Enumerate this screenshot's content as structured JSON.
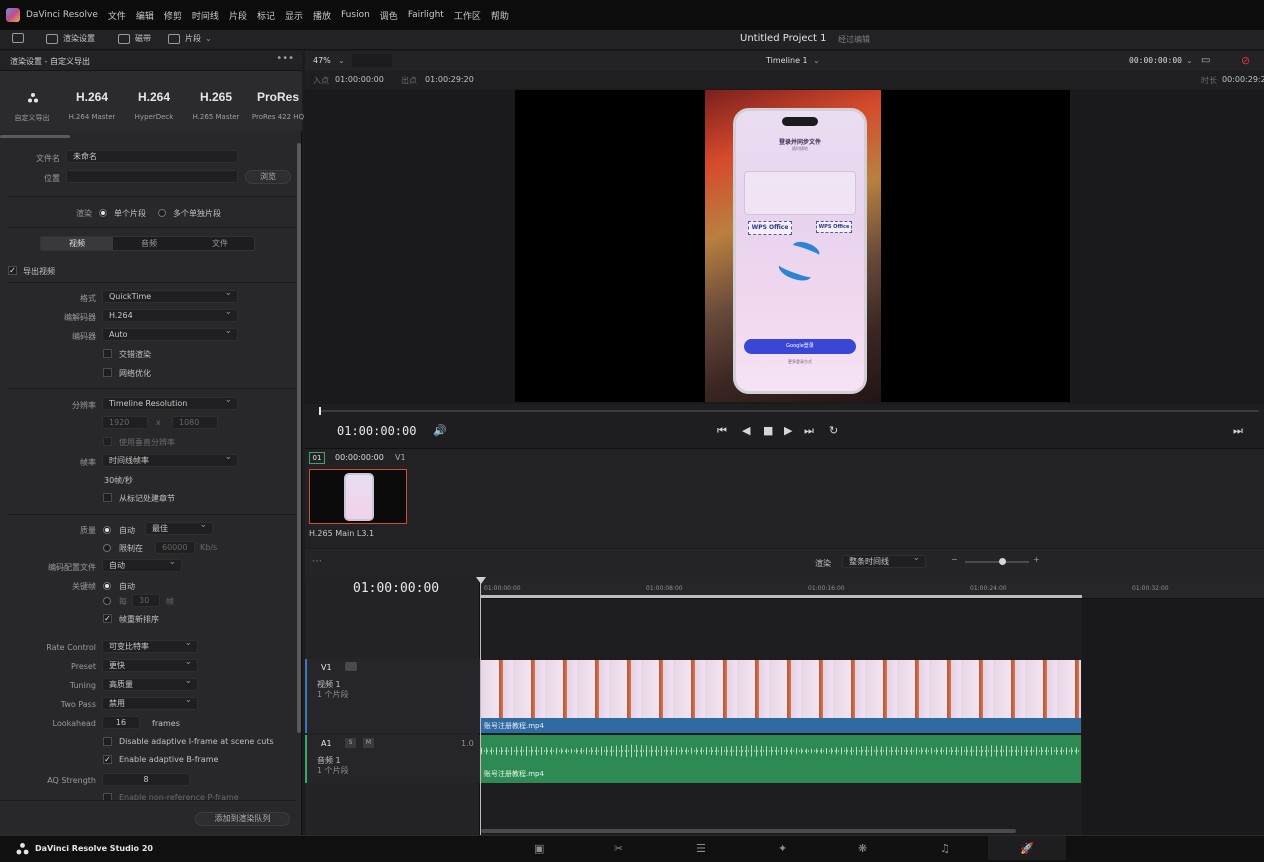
{
  "menubar": {
    "app": "DaVinci Resolve",
    "items": [
      "文件",
      "编辑",
      "修剪",
      "时间线",
      "片段",
      "标记",
      "显示",
      "播放",
      "Fusion",
      "调色",
      "Fairlight",
      "工作区",
      "帮助"
    ]
  },
  "toolbar": {
    "render_settings": "渲染设置",
    "clips": "磁带",
    "clip_label": "片段",
    "project_title": "Untitled Project 1",
    "project_sub": "经过编辑"
  },
  "render": {
    "header": "渲染设置 - 自定义导出",
    "presets": [
      {
        "name": "",
        "sub": "自定义导出"
      },
      {
        "name": "H.264",
        "sub": "H.264 Master"
      },
      {
        "name": "H.264",
        "sub": "HyperDeck"
      },
      {
        "name": "H.265",
        "sub": "H.265 Master"
      },
      {
        "name": "ProRes",
        "sub": "ProRes 422 HQ"
      }
    ],
    "filename_label": "文件名",
    "filename_value": "未命名",
    "location_label": "位置",
    "location_value": "",
    "browse": "浏览",
    "render_label": "渲染",
    "single_clip": "单个片段",
    "multi_clip": "多个单独片段",
    "tabs": [
      "视频",
      "音频",
      "文件"
    ],
    "export_video": "导出视频",
    "format_label": "格式",
    "format_value": "QuickTime",
    "codec_label": "编解码器",
    "codec_value": "H.264",
    "encoder_label": "编码器",
    "encoder_value": "Auto",
    "interlace": "交错渲染",
    "network_opt": "网络优化",
    "resolution_label": "分辨率",
    "resolution_value": "Timeline Resolution",
    "res_w": "1920",
    "res_x": "x",
    "res_h": "1080",
    "res_custom": "使用垂直分辨率",
    "framerate_label": "帧率",
    "framerate_value": "时间线帧率",
    "fps_value": "30帧/秒",
    "timecode_label": "从标记处建章节",
    "quality_label": "质量",
    "quality_auto": "自动",
    "quality_auto_value": "最佳",
    "quality_limit": "限制在",
    "quality_limit_value": "60000",
    "quality_limit_unit": "Kb/s",
    "profile_label": "编码配置文件",
    "profile_value": "自动",
    "keyframe_label": "关键帧",
    "keyframe_auto": "自动",
    "keyframe_every": "每",
    "keyframe_every_value": "30",
    "keyframe_every_unit": "帧",
    "frame_reorder": "帧重新排序",
    "rate_control_label": "Rate Control",
    "rate_control_value": "可变比特率",
    "preset_label": "Preset",
    "preset_value": "更快",
    "tuning_label": "Tuning",
    "tuning_value": "高质量",
    "twopass_label": "Two Pass",
    "twopass_value": "禁用",
    "lookahead_label": "Lookahead",
    "lookahead_value": "16",
    "lookahead_unit": "frames",
    "disable_iframe": "Disable adaptive I-frame at scene cuts",
    "enable_bframe": "Enable adaptive B-frame",
    "aq_label": "AQ Strength",
    "aq_value": "8",
    "nonref": "Enable non-reference P-frame",
    "add_queue": "添加到渲染队列"
  },
  "viewer": {
    "zoom": "47%",
    "timeline_name": "Timeline 1",
    "timecode_top": "00:00:00:00",
    "in_label": "入点",
    "in_value": "01:00:00:00",
    "out_label": "出点",
    "out_value": "01:00:29:20",
    "duration_label": "时长",
    "duration_value": "00:00:29:2",
    "current_tc": "01:00:00:00",
    "phone_title": "登录并同步文件",
    "phone_sub": "随时随地",
    "wps1": "WPS Office",
    "wps2": "WPS Office",
    "google_btn": "Google登录",
    "more_login": "更多登录方式"
  },
  "media": {
    "index": "01",
    "tc": "00:00:00:00",
    "track": "V1",
    "clip_codec": "H.265 Main L3.1"
  },
  "timeline": {
    "render_label": "渲染",
    "render_value": "整条时间线",
    "tc": "01:00:00:00",
    "ticks": [
      "01:00:00:00",
      "01:00:08:00",
      "01:00:16:00",
      "01:00:24:00",
      "01:00:32:00"
    ],
    "v1": "V1",
    "v1_name": "视频 1",
    "v1_count": "1 个片段",
    "v1_clip": "账号注册教程.mp4",
    "a1": "A1",
    "a1_s": "S",
    "a1_m": "M",
    "a1_level": "1.0",
    "a1_name": "音频 1",
    "a1_count": "1 个片段",
    "a1_clip": "账号注册教程.mp4"
  },
  "footer": {
    "app_name": "DaVinci Resolve Studio 20"
  }
}
